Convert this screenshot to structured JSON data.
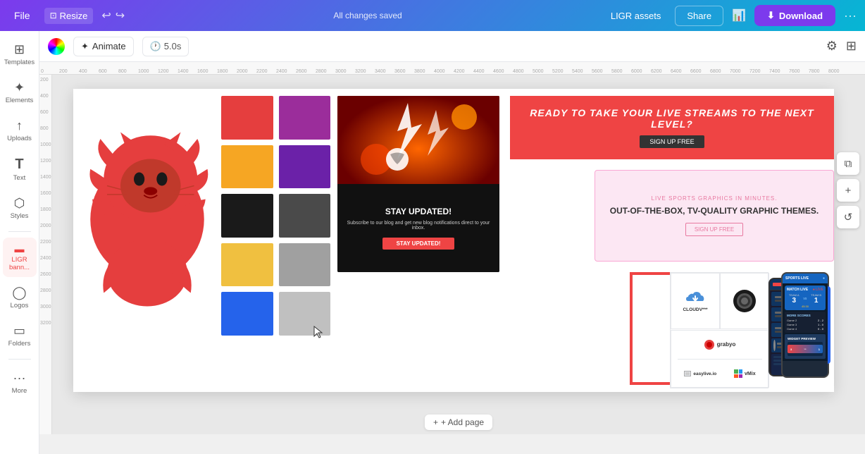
{
  "topbar": {
    "file_label": "File",
    "resize_label": "Resize",
    "saved_text": "All changes saved",
    "ligr_assets_label": "LIGR assets",
    "share_label": "Share",
    "download_label": "Download",
    "more_icon": "···"
  },
  "toolbar2": {
    "animate_label": "Animate",
    "time_label": "5.0s"
  },
  "sidebar": {
    "items": [
      {
        "label": "Templates",
        "icon": "⊞"
      },
      {
        "label": "Elements",
        "icon": "✦"
      },
      {
        "label": "Uploads",
        "icon": "↑"
      },
      {
        "label": "Text",
        "icon": "T"
      },
      {
        "label": "Styles",
        "icon": "⬡"
      },
      {
        "label": "LIGR bann...",
        "icon": "▬",
        "active": true
      },
      {
        "label": "Logos",
        "icon": "◯"
      },
      {
        "label": "Folders",
        "icon": "▭"
      },
      {
        "label": "More",
        "icon": "···"
      }
    ]
  },
  "canvas": {
    "swatches": [
      "#e53e3e",
      "#9b2d9b",
      "#f6a623",
      "#6b21a8",
      "#1a1a1a",
      "#4a4a4a",
      "#f0c040",
      "#a0a0a0",
      "#2563eb",
      "#c0c0c0"
    ],
    "red_banner_title": "READY TO TAKE YOUR LIVE STREAMS TO THE NEXT LEVEL?",
    "red_banner_btn": "SIGN UP FREE",
    "pink_card_subtitle": "LIVE SPORTS GRAPHICS IN MINUTES.",
    "pink_card_title": "OUT-OF-THE-BOX, TV-QUALITY GRAPHIC THEMES.",
    "pink_card_btn": "SIGN UP FREE",
    "sports_title": "STAY UPDATED!",
    "sports_subtitle": "Subscribe to our blog and get new blog notifications direct to your inbox.",
    "sports_cta": "STAY UPDATED!",
    "partner1": "CLOUDV***",
    "partner2": "OBS",
    "partner3": "grabyo",
    "partner4": "easylive.io",
    "partner5": "vMix"
  },
  "add_page_label": "+ Add page"
}
